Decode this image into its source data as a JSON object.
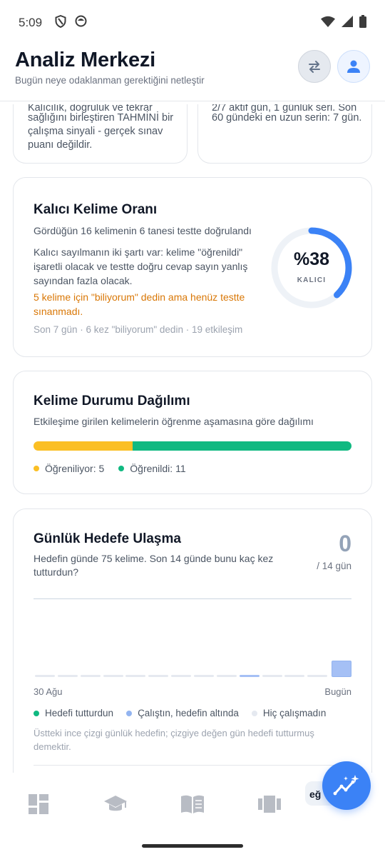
{
  "status_bar": {
    "time": "5:09"
  },
  "header": {
    "title": "Analiz Merkezi",
    "subtitle": "Bugün neye odaklanman gerektiğini netleştir"
  },
  "top_cards": {
    "left_text": "Kalıcılık, doğruluk ve tekrar sağlığını birleştiren TAHMİNİ bir çalışma sinyali - gerçek sınav puanı değildir.",
    "left_partial_line": "Kalıcılık, doğruluk ve tekrar",
    "left_lines": [
      "sağlığını birleştiren TAHMİNİ bir",
      "çalışma sinyali - gerçek sınav",
      "puanı değildir."
    ],
    "right_partial_line": "2/7 aktif gün, 1 günlük seri. Son",
    "right_lines": [
      "60 gündeki en uzun serin: 7 gün."
    ]
  },
  "kalici_card": {
    "title": "Kalıcı Kelime Oranı",
    "subtitle": "Gördüğün 16 kelimenin 6 tanesi testte doğrulandı",
    "description": "Kalıcı sayılmanın iki şartı var: kelime \"öğrenildi\" işaretli olacak ve testte doğru cevap sayın yanlış sayından fazla olacak.",
    "warning": "5 kelime için \"biliyorum\" dedin ama henüz testte sınanmadı.",
    "meta": "Son 7 gün · 6 kez \"biliyorum\" dedin · 19 etkileşim",
    "ring_value": "%38",
    "ring_fraction": 0.38,
    "ring_label": "KALICI",
    "ring_color": "#3b82f6",
    "ring_track_color": "#eef2f7"
  },
  "dagilim_card": {
    "title": "Kelime Durumu Dağılımı",
    "subtitle": "Etkileşime girilen kelimelerin öğrenme aşamasına göre dağılımı",
    "segments": [
      {
        "label": "Öğreniliyor: 5",
        "value": 5,
        "color": "#fbbf24"
      },
      {
        "label": "Öğrenildi: 11",
        "value": 11,
        "color": "#10b981"
      }
    ]
  },
  "gunluk_card": {
    "title": "Günlük Hedefe Ulaşma",
    "subtitle": "Hedefin günde 75 kelime. Son 14 günde bunu kaç kez tutturdun?",
    "count": "0",
    "count_suffix": "/ 14 gün",
    "x_start_label": "30 Ağu",
    "x_end_label": "Bugün",
    "goal": 75,
    "days": [
      {
        "status": "none",
        "fraction": 0.03
      },
      {
        "status": "none",
        "fraction": 0.03
      },
      {
        "status": "none",
        "fraction": 0.03
      },
      {
        "status": "none",
        "fraction": 0.03
      },
      {
        "status": "none",
        "fraction": 0.03
      },
      {
        "status": "none",
        "fraction": 0.03
      },
      {
        "status": "none",
        "fraction": 0.03
      },
      {
        "status": "none",
        "fraction": 0.03
      },
      {
        "status": "none",
        "fraction": 0.03
      },
      {
        "status": "below",
        "fraction": 0.03
      },
      {
        "status": "none",
        "fraction": 0.03
      },
      {
        "status": "none",
        "fraction": 0.03
      },
      {
        "status": "none",
        "fraction": 0.03
      },
      {
        "status": "below",
        "fraction": 0.21
      }
    ],
    "legend": [
      {
        "label": "Hedefi tutturdun",
        "color": "#10b981"
      },
      {
        "label": "Çalıştın, hedefin altında",
        "color": "#93b4f0"
      },
      {
        "label": "Hiç çalışmadın",
        "color": "#e5e9f0"
      }
    ],
    "colors": {
      "hit": "#10b981",
      "below": "#a5c0f5",
      "none": "#e5e9f0"
    },
    "note": "Üstteki ince çizgi günlük hedefin; çizgiye değen gün hedefi tutturmuş demektir."
  },
  "bottom_nav": {
    "partial_label": "eğ"
  }
}
